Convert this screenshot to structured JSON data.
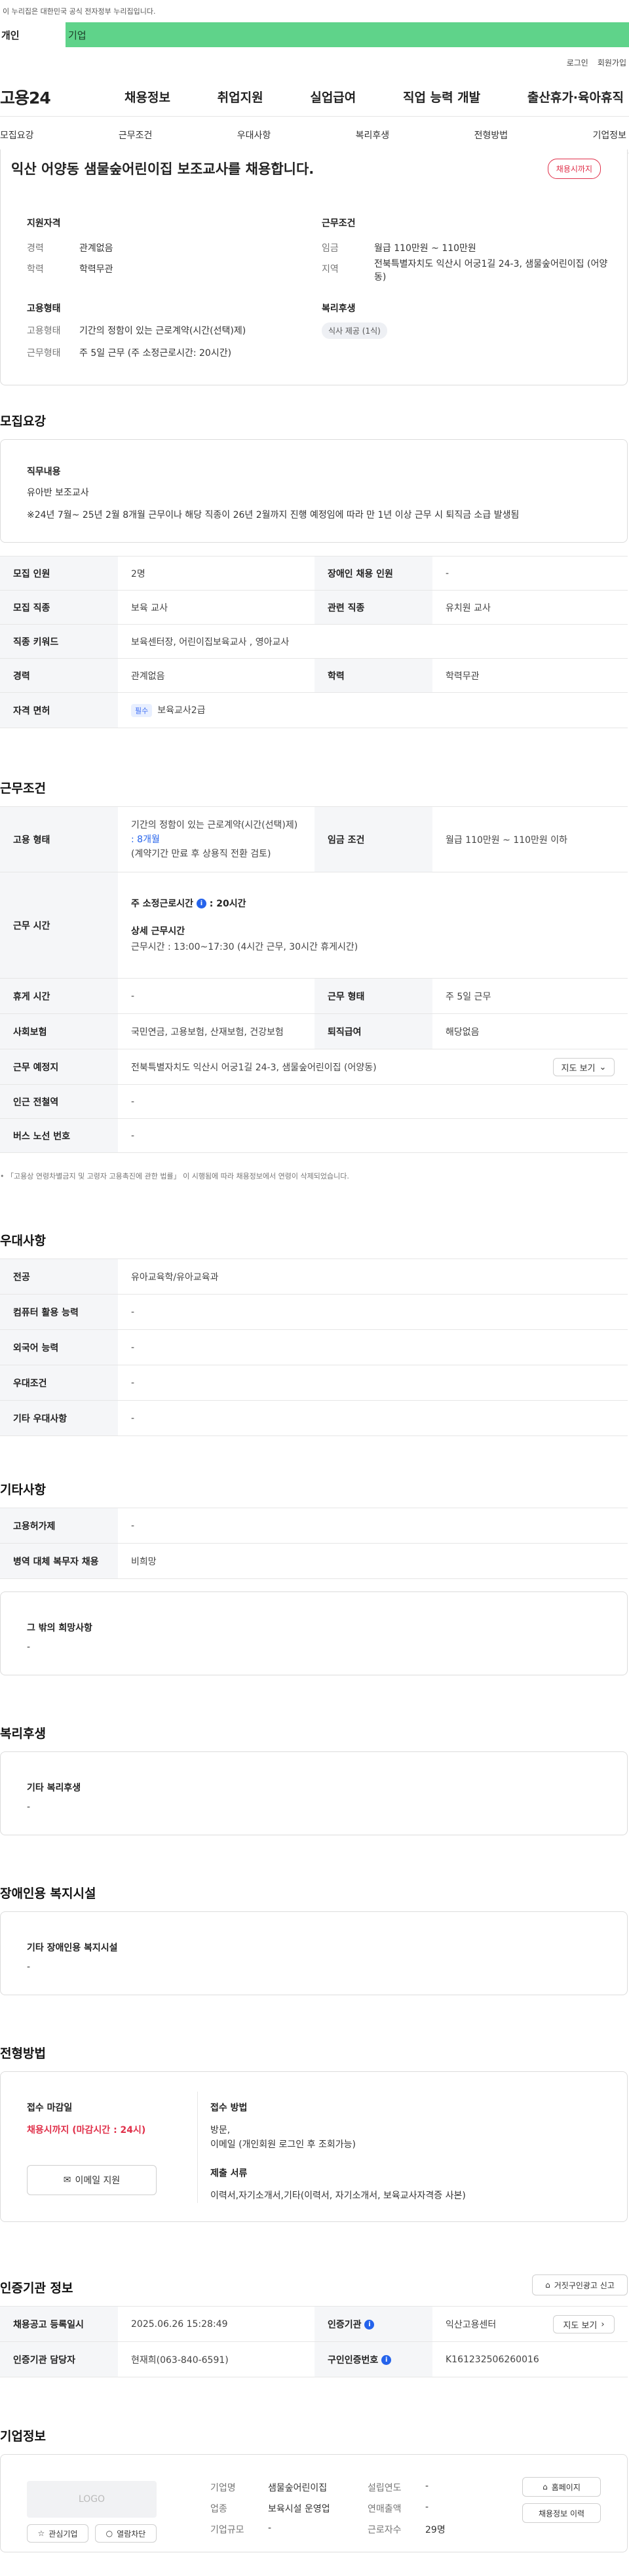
{
  "gov_banner": "이 누리집은 대한민국 공식 전자정부 누리집입니다.",
  "user_tabs": {
    "personal": "개인",
    "company": "기업"
  },
  "utils": {
    "login": "로그인",
    "join": "회원가입"
  },
  "logo": "고용24",
  "gnb": [
    "채용정보",
    "취업지원",
    "실업급여",
    "직업 능력 개발",
    "출산휴가·육아휴직"
  ],
  "anchors": [
    "모집요강",
    "근무조건",
    "우대사항",
    "복리후생",
    "전형방법",
    "기업정보"
  ],
  "summary": {
    "title": "익산 어양동 샘물숲어린이집 보조교사를 채용합니다.",
    "badge": "채용시까지",
    "qual_title": "지원자격",
    "career_label": "경력",
    "career_value": "관계없음",
    "edu_label": "학력",
    "edu_value": "학력무관",
    "cond_title": "근무조건",
    "wage_label": "임금",
    "wage_value": "월급 110만원 ~ 110만원",
    "area_label": "지역",
    "area_value": "전북특별자치도 익산시 어궁1길 24-3, 샘물숲어린이집 (어양동)",
    "emp_title": "고용형태",
    "emptype_label": "고용형태",
    "emptype_value": "기간의 정함이 있는 근로계약(시간(선택)제)",
    "worktype_label": "근무형태",
    "worktype_value": "주 5일 근무 (주 소정근로시간: 20시간)",
    "welfare_title": "복리후생",
    "welfare_chip": "식사 제공 (1식)"
  },
  "recruit": {
    "heading": "모집요강",
    "duty_title": "직무내용",
    "duty_line1": "유아반 보조교사",
    "duty_line2": "※24년 7월~ 25년 2월 8개월 근무이나 해당 직종이 26년 2월까지 진행 예정임에 따라 만 1년 이상 근무 시 퇴직금 소급 발생됨",
    "rows": {
      "count_label": "모집 인원",
      "count_value": "2명",
      "disabled_label": "장애인 채용 인원",
      "disabled_value": "-",
      "job_label": "모집 직종",
      "job_value": "보육 교사",
      "rel_label": "관련 직종",
      "rel_value": "유치원 교사",
      "kw_label": "직종 키워드",
      "kw_value": "보육센터장, 어린이집보육교사 , 영아교사",
      "career_label": "경력",
      "career_value": "관계없음",
      "edu_label": "학력",
      "edu_value": "학력무관",
      "license_label": "자격 면허",
      "license_tag": "필수",
      "license_value": "보육교사2급"
    }
  },
  "work": {
    "heading": "근무조건",
    "emp_label": "고용 형태",
    "emp_line1": "기간의 정함이 있는 근로계약(시간(선택)제)",
    "emp_line2": ": 8개월",
    "emp_line3": "(계약기간 만료 후 상용직 전환 검토)",
    "wagecond_label": "임금 조건",
    "wagecond_value": "월급 110만원 ~ 110만원 이하",
    "time_label": "근무 시간",
    "hours_title": "주 소정근로시간",
    "hours_value": ": 20시간",
    "detail_title": "상세 근무시간",
    "detail_value": "근무시간 : 13:00~17:30 (4시간 근무, 30시간 휴게시간)",
    "rest_label": "휴게 시간",
    "rest_value": "-",
    "form_label": "근무 형태",
    "form_value": "주 5일 근무",
    "ins_label": "사회보험",
    "ins_value": "국민연금, 고용보험, 산재보험, 건강보험",
    "sev_label": "퇴직급여",
    "sev_value": "해당없음",
    "place_label": "근무 예정지",
    "place_value": "전북특별자치도 익산시 어궁1길 24-3, 샘물숲어린이집 (어양동)",
    "map_btn": "지도 보기",
    "subway_label": "인근 전철역",
    "subway_value": "-",
    "bus_label": "버스 노선 번호",
    "bus_value": "-",
    "note": "「고용상 연령차별금지 및 고령자 고용촉진에 관한 법률」 이 시행됨에 따라 채용정보에서 연령이 삭제되었습니다."
  },
  "pref": {
    "heading": "우대사항",
    "major_label": "전공",
    "major_value": "유아교육학/유아교육과",
    "comp_label": "컴퓨터 활용 능력",
    "comp_value": "-",
    "lang_label": "외국어 능력",
    "lang_value": "-",
    "cond_label": "우대조건",
    "cond_value": "-",
    "etc_label": "기타 우대사항",
    "etc_value": "-"
  },
  "other": {
    "heading": "기타사항",
    "perm_label": "고용허가제",
    "perm_value": "-",
    "mil_label": "병역 대체 복무자 채용",
    "mil_value": "비희망",
    "wish_title": "그 밖의 희망사항",
    "wish_value": "-"
  },
  "welfare": {
    "heading": "복리후생",
    "title": "기타 복리후생",
    "value": "-"
  },
  "disab": {
    "heading": "장애인용 복지시설",
    "title": "기타 장애인용 복지시설",
    "value": "-"
  },
  "process": {
    "heading": "전형방법",
    "deadline_title": "접수 마감일",
    "deadline_value": "채용시까지 (마감시간 : 24시)",
    "email_btn": "이메일 지원",
    "method_title": "접수 방법",
    "method_line1": "방문,",
    "method_line2": "이메일 (개인회원 로그인 후 조회가능)",
    "docs_title": "제출 서류",
    "docs_value": "이력서,자기소개서,기타(이력서, 자기소개서, 보육교사자격증 사본)"
  },
  "cert": {
    "heading": "인증기관 정보",
    "report_btn": "거짓구인광고 신고",
    "reg_label": "채용공고 등록일시",
    "reg_value": "2025.06.26 15:28:49",
    "org_label": "인증기관",
    "org_value": "익산고용센터",
    "map_btn": "지도 보기",
    "mgr_label": "인증기관 담당자",
    "mgr_value": "현재희(063-840-6591)",
    "num_label": "구인인증번호",
    "num_value": "K161232506260016"
  },
  "company": {
    "heading": "기업정보",
    "logo_text": "LOGO",
    "fav_btn": "관심기업",
    "block_btn": "열람차단",
    "name_label": "기업명",
    "name_value": "샘물숲어린이집",
    "ind_label": "업종",
    "ind_value": "보육시설 운영업",
    "size_label": "기업규모",
    "size_value": "-",
    "est_label": "설립연도",
    "est_value": "-",
    "sales_label": "연매출액",
    "sales_value": "-",
    "emp_label": "근로자수",
    "emp_value": "29명",
    "home_btn": "홈페이지",
    "history_btn": "채용정보 이력"
  }
}
